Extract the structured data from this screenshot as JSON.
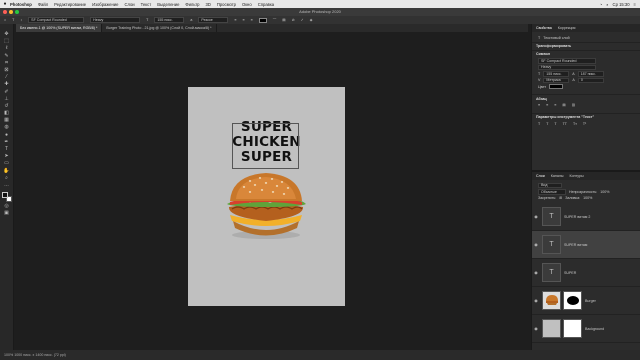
{
  "menubar": {
    "apple": "",
    "items": [
      "Photoshop",
      "Файл",
      "Редактирование",
      "Изображение",
      "Слои",
      "Текст",
      "Выделение",
      "Фильтр",
      "3D",
      "Просмотр",
      "Окно",
      "Справка"
    ],
    "clock": "Ср 15:30"
  },
  "window": {
    "title": "Adobe Photoshop 2020"
  },
  "options": {
    "font_family": "SF Compact Rounded",
    "font_style": "Heavy",
    "font_size": "155 пикс.",
    "antialias": "Резкое"
  },
  "tabs": [
    "Без имени-1 @ 100% (SUPER витам, RGB/8) *",
    "Burger Training Photo - 21.jpg @ 100% (Слой 0, Слой-маска/8) *"
  ],
  "document": {
    "line1": "SUPER",
    "line2": "CHICKEN",
    "line3": "SUPER"
  },
  "properties": {
    "tabs": [
      "Свойства",
      "Коррекция"
    ],
    "layer_kind": "Текстовый слой",
    "sections": {
      "transform": "Трансформировать",
      "character": "Символ",
      "paragraph": "Абзац",
      "tool_params": "Параметры инструмента \"Текст\""
    },
    "font_family": "SF Compact Rounded",
    "font_style": "Heavy",
    "size": "155 пикс.",
    "leading": "187 пикс.",
    "tracking_label": "Метрика",
    "tracking": "0",
    "color_label": "Цвет"
  },
  "layers_panel": {
    "tabs": [
      "Слои",
      "Каналы",
      "Контуры"
    ],
    "filter": "Вид",
    "blend_mode": "Обычные",
    "opacity_label": "Непрозрачность:",
    "opacity": "100%",
    "lock_label": "Закрепить:",
    "fill_label": "Заливка:",
    "fill": "100%",
    "layers": [
      {
        "name": "SUPER витам 2",
        "type": "text"
      },
      {
        "name": "SUPER витам",
        "type": "text"
      },
      {
        "name": "SUPER",
        "type": "text"
      },
      {
        "name": "Burger",
        "type": "image"
      },
      {
        "name": "Background",
        "type": "image"
      }
    ]
  },
  "status": {
    "text": "100%   1000 пикс. x 1400 пикс. (72 ppi)"
  },
  "colors": {
    "foreground": "#111111",
    "background": "#ffffff",
    "canvas_bg": "#c0c0c0"
  }
}
